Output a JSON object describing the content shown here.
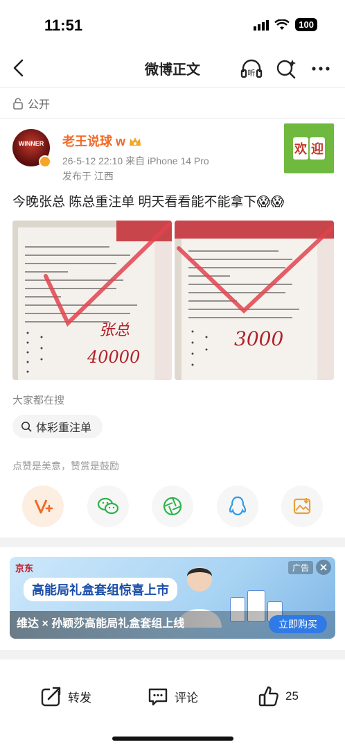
{
  "status_bar": {
    "time": "11:51",
    "battery": "100"
  },
  "nav": {
    "title": "微博正文",
    "listen_label": "听"
  },
  "post": {
    "visibility": "公开",
    "author": {
      "name": "老王说球",
      "verified_mark": "w",
      "avatar_text": "WINNER",
      "meta": "26-5-12 22:10  来自 iPhone 14 Pro",
      "location": "发布于 江西"
    },
    "card_decoration": [
      "欢",
      "迎"
    ],
    "text": "今晚张总 陈总重注单 明天看看能不能拿下😱😱",
    "images": [
      {
        "handwriting_name": "张总",
        "handwriting_amount": "40000"
      },
      {
        "handwriting_amount": "3000"
      }
    ]
  },
  "search": {
    "label": "大家都在搜",
    "chip": "体彩重注单"
  },
  "reward": {
    "label": "点赞是美意，赞赏是鼓励"
  },
  "ad": {
    "brand": "京东",
    "tag": "广告",
    "slogan": "高能局礼盒套组惊喜上市",
    "title": "维达 × 孙颖莎高能局礼盒套组上线",
    "cta": "立即购买"
  },
  "actions": {
    "repost": "转发",
    "comment": "评论",
    "like_count": "25"
  },
  "colors": {
    "accent": "#f16a26",
    "ad_button": "#2f7ae5",
    "check_mark": "#e2434d"
  }
}
